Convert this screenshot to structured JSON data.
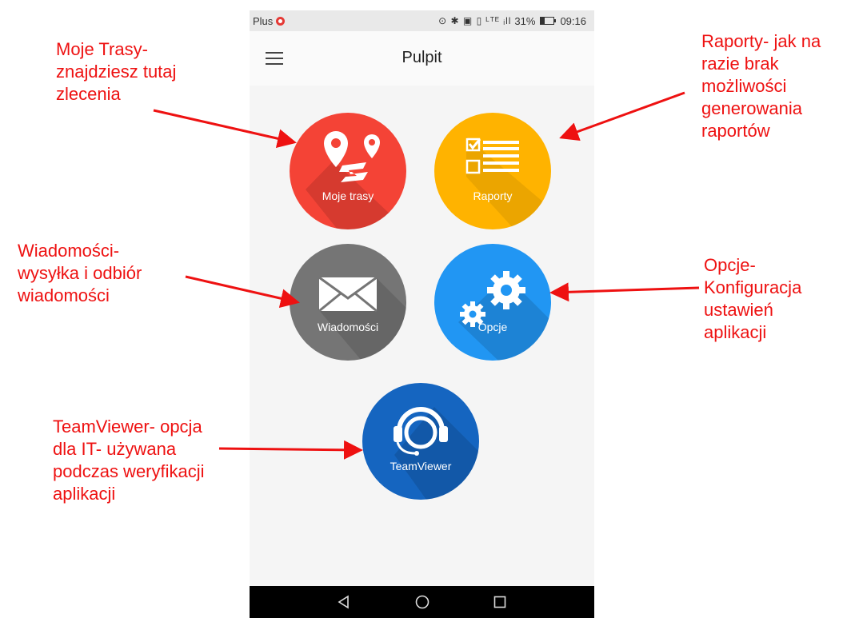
{
  "status_bar": {
    "carrier": "Plus",
    "icons": "⊙ ✱ ▣ ▯ ᴸᵀᴱ ᵢll",
    "battery_percent": "31%",
    "time": "09:16"
  },
  "app_bar": {
    "title": "Pulpit",
    "menu_icon": "hamburger-menu-icon"
  },
  "tiles": {
    "routes": {
      "label": "Moje trasy",
      "color": "#f44336",
      "icon": "route-pins-icon"
    },
    "reports": {
      "label": "Raporty",
      "color": "#ffb300",
      "icon": "checklist-icon"
    },
    "messages": {
      "label": "Wiadomości",
      "color": "#757575",
      "icon": "envelope-icon"
    },
    "options": {
      "label": "Opcje",
      "color": "#2196f3",
      "icon": "gears-icon"
    },
    "teamviewer": {
      "label": "TeamViewer",
      "color": "#1565c0",
      "icon": "headset-icon"
    }
  },
  "nav_bar": {
    "back_icon": "back-triangle-icon",
    "home_icon": "home-circle-icon",
    "recent_icon": "recent-square-icon"
  },
  "annotations": {
    "routes": [
      "Moje Trasy-",
      "znajdziesz tutaj",
      "zlecenia"
    ],
    "reports": [
      "Raporty- jak na",
      "razie brak",
      "możliwości",
      "generowania",
      "raportów"
    ],
    "messages": [
      "Wiadomości-",
      "wysyłka i odbiór",
      "wiadomości"
    ],
    "options": [
      "Opcje-",
      "Konfiguracja",
      "ustawień",
      "aplikacji"
    ],
    "teamviewer": [
      "TeamViewer- opcja",
      "dla IT- używana",
      "podczas weryfikacji",
      "aplikacji"
    ],
    "color": "#ee1111"
  }
}
